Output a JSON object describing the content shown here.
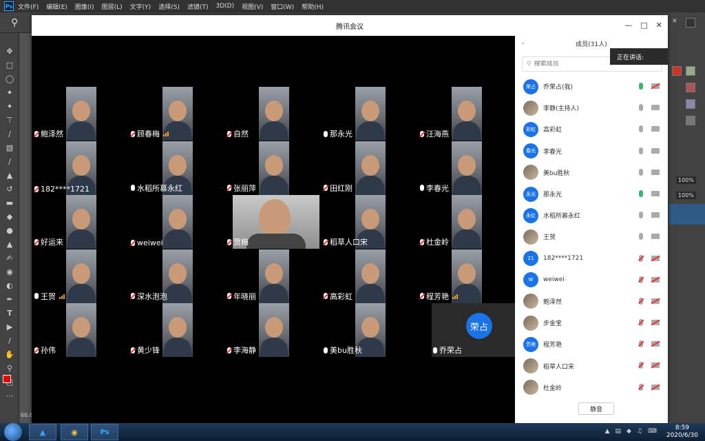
{
  "ps": {
    "logo": "Ps",
    "menu": [
      "文件(F)",
      "编辑(E)",
      "图像(I)",
      "图层(L)",
      "文字(Y)",
      "选择(S)",
      "滤镜(T)",
      "3D(D)",
      "视图(V)",
      "窗口(W)",
      "帮助(H)"
    ],
    "zoom": "66.6",
    "panel_percent_1": "100%",
    "panel_percent_2": "100%"
  },
  "meeting": {
    "title": "腾讯会议",
    "speaking_label": "正在讲话:",
    "grid_tiles": [
      {
        "name": "鲍泽然",
        "muted": true
      },
      {
        "name": "顾春梅",
        "muted": true
      },
      {
        "name": "自然",
        "muted": true
      },
      {
        "name": "那永光",
        "muted": false
      },
      {
        "name": "汪海燕",
        "muted": true
      },
      {
        "name": "182****1721",
        "muted": true
      },
      {
        "name": "水稻所慕永红",
        "muted": false
      },
      {
        "name": "张丽萍",
        "muted": true
      },
      {
        "name": "田红刚",
        "muted": true
      },
      {
        "name": "李春光",
        "muted": false
      },
      {
        "name": "好运来",
        "muted": true
      },
      {
        "name": "weiwei",
        "muted": true
      },
      {
        "name": "贺梅",
        "muted": true
      },
      {
        "name": "稻草人口宋",
        "muted": true
      },
      {
        "name": "杜金岭",
        "muted": true
      },
      {
        "name": "王贺",
        "muted": false
      },
      {
        "name": "深水泡泡",
        "muted": true
      },
      {
        "name": "年晓丽",
        "muted": true
      },
      {
        "name": "高彩虹",
        "muted": true
      },
      {
        "name": "程芳艳",
        "muted": true
      },
      {
        "name": "孙伟",
        "muted": true
      },
      {
        "name": "黄少锋",
        "muted": true
      },
      {
        "name": "李海静",
        "muted": true
      },
      {
        "name": "美bu胜秋",
        "muted": false
      },
      {
        "name": "乔荣占",
        "muted": false
      }
    ],
    "avatar_tile_text": "荣占",
    "panel": {
      "header": "成员(31人)",
      "search_placeholder": "搜索成员",
      "mute_all": "静音",
      "members": [
        {
          "avatar": "荣占",
          "name": "乔荣占(我)"
        },
        {
          "avatar": "",
          "name": "李静(主持人)"
        },
        {
          "avatar": "彩虹",
          "name": "高彩虹"
        },
        {
          "avatar": "春光",
          "name": "李春光"
        },
        {
          "avatar": "",
          "name": "美bu胜秋"
        },
        {
          "avatar": "永光",
          "name": "那永光"
        },
        {
          "avatar": "永红",
          "name": "水稻所慕永红"
        },
        {
          "avatar": "",
          "name": "王贺"
        },
        {
          "avatar": "21",
          "name": "182****1721"
        },
        {
          "avatar": "W",
          "name": "weiwei"
        },
        {
          "avatar": "",
          "name": "鲍泽然"
        },
        {
          "avatar": "",
          "name": "步金宝"
        },
        {
          "avatar": "芳艳",
          "name": "程芳艳"
        },
        {
          "avatar": "",
          "name": "稻草人口宋"
        },
        {
          "avatar": "",
          "name": "杜金岭"
        }
      ]
    }
  },
  "taskbar": {
    "time": "8:59",
    "date": "2020/6/30",
    "ps_label": "Ps"
  }
}
